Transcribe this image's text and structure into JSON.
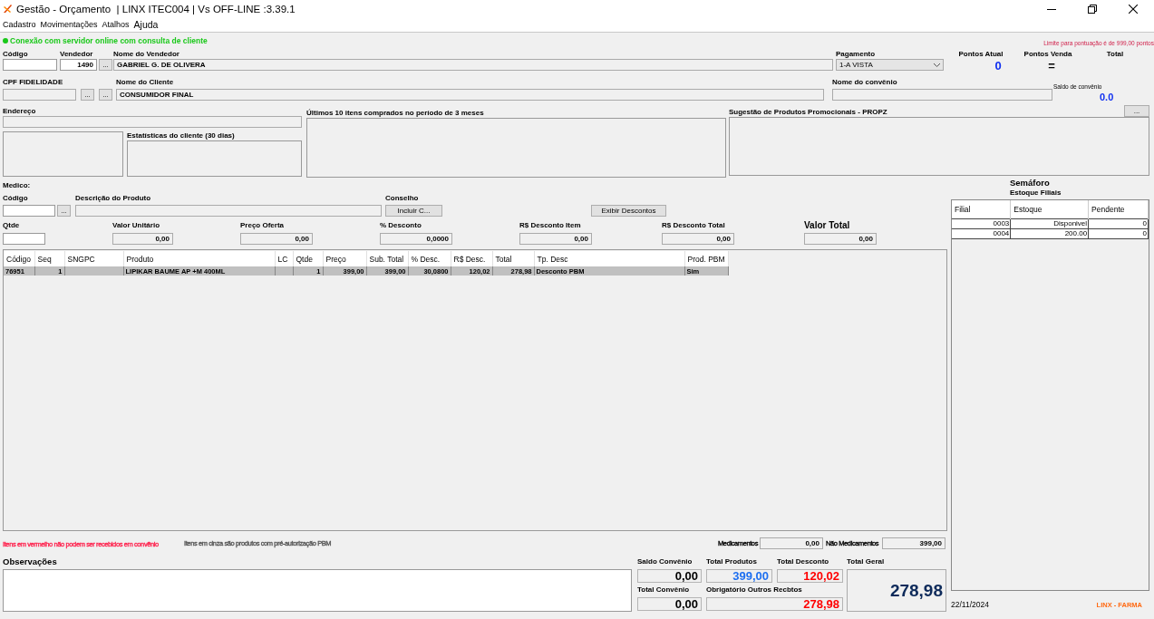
{
  "window": {
    "title": "Gestão - Orçamento  | LINX ITEC004 | Vs OFF-LINE :3.39.1"
  },
  "menu": [
    {
      "label": "Cadastro"
    },
    {
      "label": "Movimentações"
    },
    {
      "label": "Atalhos"
    },
    {
      "label": "Ajuda"
    }
  ],
  "connection": {
    "online": true,
    "text": "Conexão com servidor online com consulta de cliente"
  },
  "points_limit": "Limite para pontuação é de 999,00 pontos",
  "seller": {
    "code_label": "Código",
    "seller_label": "Vendedor",
    "seller_code": "1490",
    "lookup_button": "...",
    "name_label": "Nome do Vendedor",
    "name": "GABRIEL G. DE OLIVERA"
  },
  "payment": {
    "label": "Pagamento",
    "value": "1-A VISTA"
  },
  "points": {
    "current_label": "Pontos Atual",
    "current": "0",
    "sale_label": "Pontos Venda",
    "sale": "=",
    "total_label": "Total"
  },
  "customer": {
    "cpf_label": "CPF FIDELIDADE",
    "buttons": [
      "...",
      "..."
    ],
    "name_label": "Nome do Cliente",
    "name": "CONSUMIDOR FINAL",
    "agreement_label": "Nome do convênio",
    "balance_label": "Saldo de convênio",
    "balance": "0.0",
    "address_label": "Endereço"
  },
  "stats": {
    "label": "Estatísticas do cliente  (30 dias)"
  },
  "recent_items": {
    "label": "Últimos 10 itens comprados no período de 3 meses"
  },
  "promotions": {
    "label": "Sugestão de Produtos Promocionais - PROPZ",
    "button": "..."
  },
  "doctor_label": "Medico:",
  "product": {
    "code_label": "Código",
    "lookup_button": "...",
    "description_label": "Descrição do Produto",
    "council_label": "Conselho",
    "include_button": "Incluir C...",
    "discounts_button": "Exibir Descontos"
  },
  "amounts": [
    {
      "label": "Qtde"
    },
    {
      "label": "Valor Unitário",
      "value": "0,00"
    },
    {
      "label": "Preço Oferta",
      "value": "0,00"
    },
    {
      "label": "% Desconto",
      "value": "0,0000"
    },
    {
      "label": "R$ Desconto Item",
      "value": "0,00"
    },
    {
      "label": "R$ Desconto Total",
      "value": "0,00"
    },
    {
      "label": "Valor Total",
      "value": "0,00"
    }
  ],
  "items_table": {
    "columns": [
      "Código",
      "Seq",
      "SNGPC",
      "Produto",
      "LC",
      "Qtde",
      "Preço",
      "Sub. Total",
      "% Desc.",
      "R$ Desc.",
      "Total",
      "Tp. Desc",
      "Prod. PBM"
    ],
    "rows": [
      {
        "selected": true,
        "cells": [
          "76951",
          "1",
          "",
          "LIPIKAR BAUME AP +M 400ML",
          "",
          "1",
          "399,00",
          "399,00",
          "30,0800",
          "120,02",
          "278,98",
          "Desconto PBM",
          "Sim"
        ]
      }
    ]
  },
  "stock": {
    "title": "Semáforo",
    "subtitle": "Estoque Filiais",
    "columns": [
      "Filial",
      "Estoque",
      "Pendente"
    ],
    "rows": [
      [
        "0003",
        "Disponivel",
        "0"
      ],
      [
        "0004",
        "200.00",
        "0"
      ]
    ]
  },
  "notes": [
    {
      "text": "Itens em vermelho não podem ser recebidos em convênio",
      "color": "#ff1f4b"
    },
    {
      "text": "Itens em cinza são produtos com pré-autorização PBM",
      "color": "#555555"
    }
  ],
  "category_totals": [
    {
      "label": "Medicamentos",
      "value": "0,00"
    },
    {
      "label": "Não Medicamentos",
      "value": "399,00"
    }
  ],
  "observations": {
    "label": "Observações"
  },
  "totals": [
    {
      "label": "Saldo Convênio",
      "value": "0,00",
      "color": "#000000"
    },
    {
      "label": "Total Produtos",
      "value": "399,00",
      "color": "#1e6ff0"
    },
    {
      "label": "Total Desconto",
      "value": "120,02",
      "color": "#ff0000"
    },
    {
      "label": "Total Convênio",
      "value": "0,00",
      "color": "#000000"
    },
    {
      "label": "Obrigatório Outros Recbtos",
      "value": "278,98",
      "color": "#ff0000"
    }
  ],
  "grand_total": {
    "label": "Total Geral",
    "value": "278,98"
  },
  "footer": {
    "date": "22/11/2024",
    "brand": "LINX - FARMA"
  }
}
